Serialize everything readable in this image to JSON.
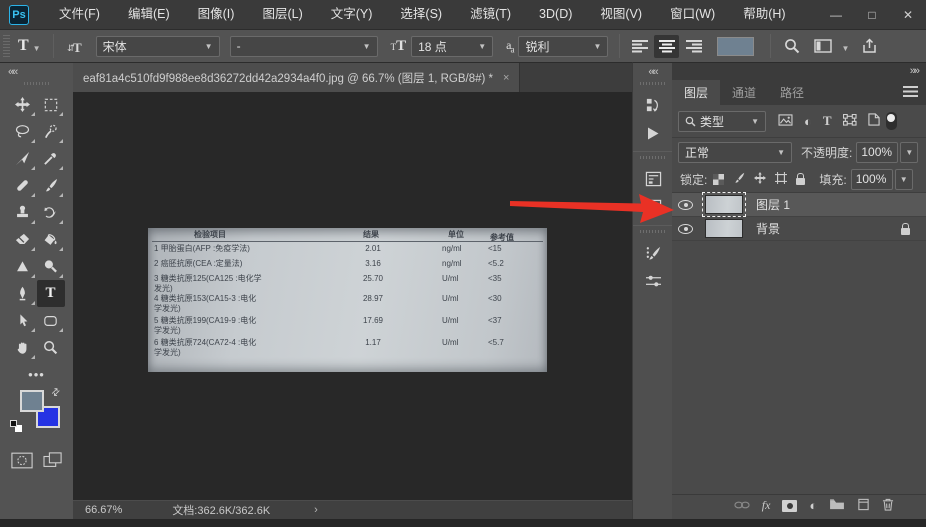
{
  "titlebar": {
    "logo": "Ps",
    "menus": [
      "文件(F)",
      "编辑(E)",
      "图像(I)",
      "图层(L)",
      "文字(Y)",
      "选择(S)",
      "滤镜(T)",
      "3D(D)",
      "视图(V)",
      "窗口(W)",
      "帮助(H)"
    ],
    "window": {
      "minimize": "—",
      "maximize": "□",
      "close": "✕"
    }
  },
  "options": {
    "tool_letter": "T",
    "font_family": "宋体",
    "font_style": "-",
    "font_size": "18 点",
    "anti_alias": "锐利"
  },
  "document_tab": {
    "title": "eaf81a4c510fd9f988ee8d36272dd42a2934a4f0.jpg @ 66.7% (图层 1, RGB/8#) *",
    "close": "×"
  },
  "photo": {
    "columns": [
      "检验项目",
      "结果",
      "单位",
      "参考值"
    ],
    "rows": [
      {
        "line1": "1 甲胎蛋白(AFP :免疫学法)",
        "line2": "",
        "result": "2.01",
        "unit": "ng/ml",
        "ref": "<15"
      },
      {
        "line1": "2 癌胚抗原(CEA :定量法)",
        "line2": "",
        "result": "3.16",
        "unit": "ng/ml",
        "ref": "<5.2"
      },
      {
        "line1": "3 糖类抗原125(CA125 :电化学",
        "line2": "发光)",
        "result": "25.70",
        "unit": "U/ml",
        "ref": "<35"
      },
      {
        "line1": "4 糖类抗原153(CA15-3 :电化",
        "line2": "学发光)",
        "result": "28.97",
        "unit": "U/ml",
        "ref": "<30"
      },
      {
        "line1": "5 糖类抗原199(CA19-9 :电化",
        "line2": "学发光)",
        "result": "17.69",
        "unit": "U/ml",
        "ref": "<37"
      },
      {
        "line1": "6 糖类抗原724(CA72-4 :电化",
        "line2": "学发光)",
        "result": "1.17",
        "unit": "U/ml",
        "ref": "<5.7"
      }
    ]
  },
  "panel": {
    "tabs": [
      "图层",
      "通道",
      "路径"
    ],
    "filter_label": "类型",
    "blend_mode": "正常",
    "opacity_label": "不透明度:",
    "opacity_value": "100%",
    "lock_label": "锁定:",
    "fill_label": "填充:",
    "fill_value": "100%",
    "layers": [
      {
        "name": "图层 1"
      },
      {
        "name": "背景"
      }
    ]
  },
  "status": {
    "zoom": "66.67%",
    "doc": "文档:362.6K/362.6K",
    "chevron": "›"
  },
  "colors": {
    "accent_red": "#e93125",
    "foreground_swatch": "#6f8191",
    "background_swatch": "#2533e4"
  }
}
